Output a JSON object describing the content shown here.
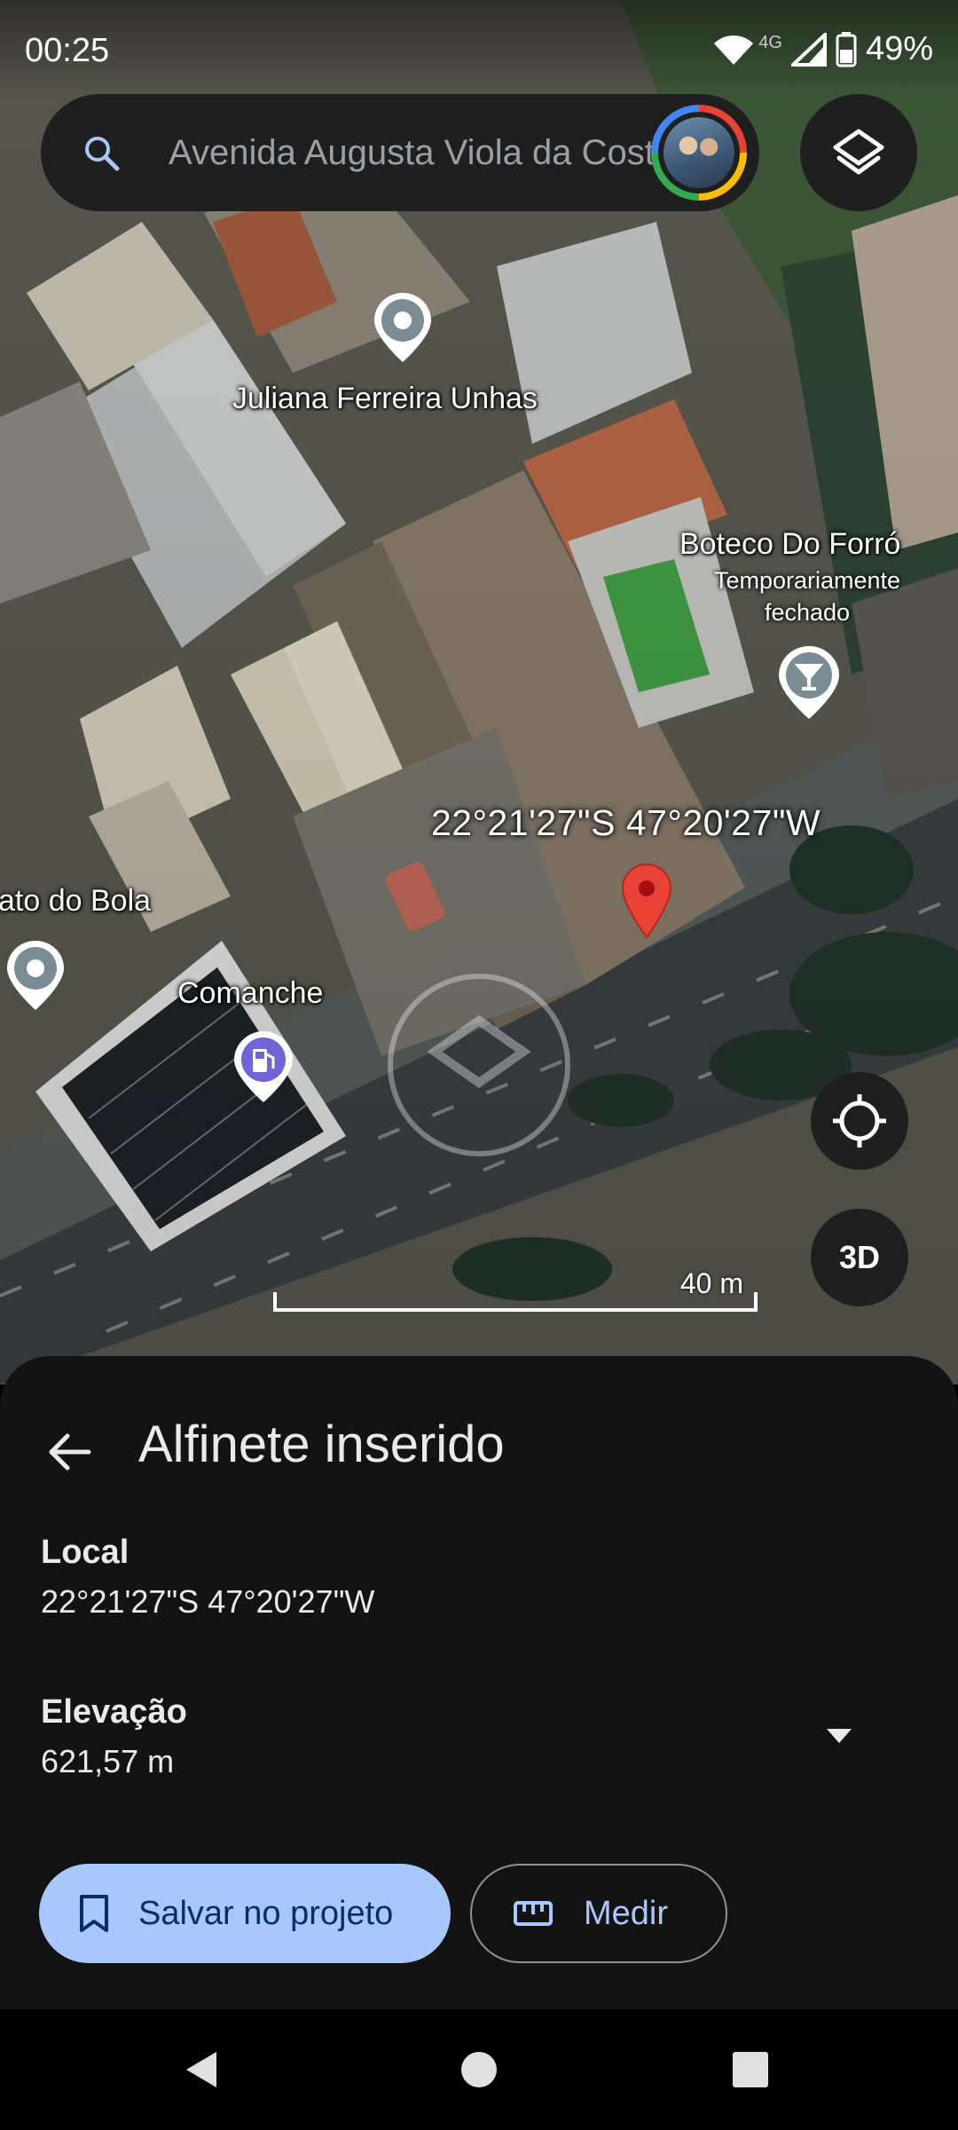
{
  "status_bar": {
    "time": "00:25",
    "network": "4G",
    "battery": "49%"
  },
  "search": {
    "placeholder": "Avenida Augusta Viola da Costa"
  },
  "map": {
    "pois": [
      {
        "name": "Juliana Ferreira Unhas"
      },
      {
        "name": "Boteco Do Forró",
        "status": "Temporariamente fechado"
      },
      {
        "name": "ato do Bola"
      },
      {
        "name": "Comanche"
      }
    ],
    "dropped_pin_label": "22°21'27\"S 47°20'27\"W",
    "scale_label": "40 m",
    "button_3d": "3D"
  },
  "sheet": {
    "title": "Alfinete inserido",
    "location_label": "Local",
    "location_value": "22°21'27\"S 47°20'27\"W",
    "elevation_label": "Elevação",
    "elevation_value": "621,57 m",
    "save_button": "Salvar no projeto",
    "measure_button": "Medir"
  },
  "colors": {
    "accent_button_bg": "#a8c7fa",
    "accent_button_text": "#062e6f",
    "sheet_bg": "#131313",
    "pin_red": "#ea4335"
  },
  "icons": [
    "search-icon",
    "layers-icon",
    "my-location-icon",
    "back-arrow-icon",
    "dropdown-arrow-icon",
    "bookmark-icon",
    "ruler-icon",
    "nav-back-icon",
    "nav-home-icon",
    "nav-recents-icon",
    "bar-icon",
    "fuel-icon",
    "place-pin-icon"
  ]
}
